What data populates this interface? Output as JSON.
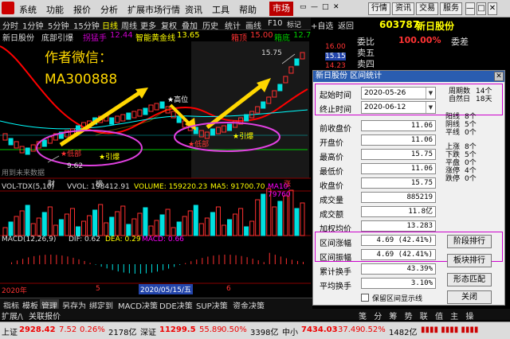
{
  "menu": {
    "items": [
      "系统",
      "功能",
      "报价",
      "分析",
      "扩展市场行情",
      "资讯",
      "工具",
      "帮助"
    ],
    "market": "市场",
    "right_buttons": [
      "行情",
      "资讯",
      "交易",
      "服务"
    ],
    "window_controls": [
      "▭",
      "—",
      "□",
      "✕"
    ]
  },
  "toolbar": {
    "periods": [
      "分时",
      "1分钟",
      "5分钟",
      "15分钟",
      "日线",
      "周线",
      "更多"
    ],
    "tools": [
      "复权",
      "叠加",
      "历史",
      "统计",
      "画线",
      "F10",
      "标记",
      "+自选",
      "返回"
    ]
  },
  "chart_header": {
    "stock": "新日股份",
    "indicator": "底部引爆",
    "rocket": "拐猛手",
    "rocket_val": "12.44",
    "gold_line_label": "智能黄金线",
    "gold_line_val": "13.65",
    "box_label": "箱顶",
    "box_val": "15.00",
    "box2_label": "箱底",
    "box2_val": "12.7"
  },
  "annotations": {
    "author": "作者微信：",
    "wechat": "MA300888",
    "high": "高位",
    "bottom1": "低部",
    "ignite1": "引爆",
    "bottom2": "低部",
    "ignite2": "引爆",
    "peak": "15.75",
    "low": "9.62",
    "watermark": "用到未来数据",
    "cai": "财",
    "bang": "榜",
    "zhang": "涨"
  },
  "price_scale": [
    "16.00",
    "15.15",
    "14.23"
  ],
  "volume": {
    "label": "VOL-TDX(5,10)",
    "vvol": "VVOL: 198412.91",
    "volume": "VOLUME: 159220.23",
    "ma5": "MA5: 91700.70",
    "ma10": "MA10: 79760"
  },
  "macd": {
    "label": "MACD(12,26,9)",
    "dif": "DIF: 0.62",
    "dea": "DEA: 0.29",
    "macd": "MACD: 0.66"
  },
  "dates": {
    "year": "2020年",
    "tick1": "5",
    "cursor": "2020/05/15/五",
    "tick2": "6"
  },
  "right_panel": {
    "code": "603787",
    "name": "新日股份",
    "weibi_label": "委比",
    "weibi_val": "100.00%",
    "weicha_label": "委差",
    "sell5": "卖五",
    "sell4": "卖四",
    "p1": "16.00",
    "p2": "15.15",
    "p3": "14.23"
  },
  "dialog": {
    "title": "新日股份 区间统计",
    "close": "✕",
    "start_label": "起始时间",
    "start_val": "2020-05-26",
    "end_label": "终止时间",
    "end_val": "2020-06-12",
    "period_label": "周期数",
    "period_val": "14个",
    "natural_label": "自然日",
    "natural_val": "18天",
    "rows": [
      {
        "label": "前收盘价",
        "value": "11.06"
      },
      {
        "label": "开盘价",
        "value": "11.06"
      },
      {
        "label": "最高价",
        "value": "15.75"
      },
      {
        "label": "最低价",
        "value": "11.06"
      },
      {
        "label": "收盘价",
        "value": "15.75"
      },
      {
        "label": "成交量",
        "value": "885219"
      },
      {
        "label": "成交额",
        "value": "11.8亿"
      },
      {
        "label": "加权均价",
        "value": "13.283"
      },
      {
        "label": "区间涨幅",
        "value": "4.69 (42.41%)"
      },
      {
        "label": "区间振幅",
        "value": "4.69 (42.41%)"
      },
      {
        "label": "累计换手",
        "value": "43.39%"
      },
      {
        "label": "平均换手",
        "value": "3.10%"
      }
    ],
    "stats1": [
      {
        "label": "阳线",
        "value": "8个"
      },
      {
        "label": "阴线",
        "value": "5个"
      },
      {
        "label": "平线",
        "value": "0个"
      }
    ],
    "stats2": [
      {
        "label": "上涨",
        "value": "8个"
      },
      {
        "label": "下跌",
        "value": "5个"
      },
      {
        "label": "平盘",
        "value": "0个"
      },
      {
        "label": "涨停",
        "value": "4个"
      },
      {
        "label": "跌停",
        "value": "0个"
      }
    ],
    "btn_stage": "阶段排行",
    "btn_block": "板块排行",
    "btn_pattern": "形态匹配",
    "btn_close": "关闭",
    "checkbox": "保留区间显示线"
  },
  "bottom_tabs": [
    "指标",
    "模板",
    "管理",
    "另存为",
    "绑定到",
    "MACD决策",
    "DDE决策",
    "SUP决策",
    "资金决策"
  ],
  "bottom_tabs2": [
    "扩展/\\",
    "关联报价"
  ],
  "bottom_right": [
    "笺",
    "分",
    "筹",
    "\\",
    "势",
    "\\",
    "联",
    "\\",
    "值",
    "\\",
    "主",
    "\\",
    "操",
    "\\",
    "\\",
    "\\",
    "\\",
    "\\"
  ],
  "status": {
    "sh_label": "上证",
    "sh_val": "2928.42",
    "sh_chg": "7.52",
    "sh_pct": "0.26%",
    "sh_amt": "2178亿",
    "sz_label": "深证",
    "sz_val": "11299.5",
    "sz_chg": "55.89",
    "sz_pct": "0.50%",
    "sz_amt": "3398亿",
    "zx_label": "中小",
    "zx_val": "7434.03",
    "zx_chg": "37.49",
    "zx_pct": "0.52%",
    "zx_amt": "1482亿"
  },
  "colors": {
    "up": "#ff3030",
    "down": "#00e0e0",
    "accent": "#c000c0",
    "dialog_title": "#2a5db0"
  }
}
